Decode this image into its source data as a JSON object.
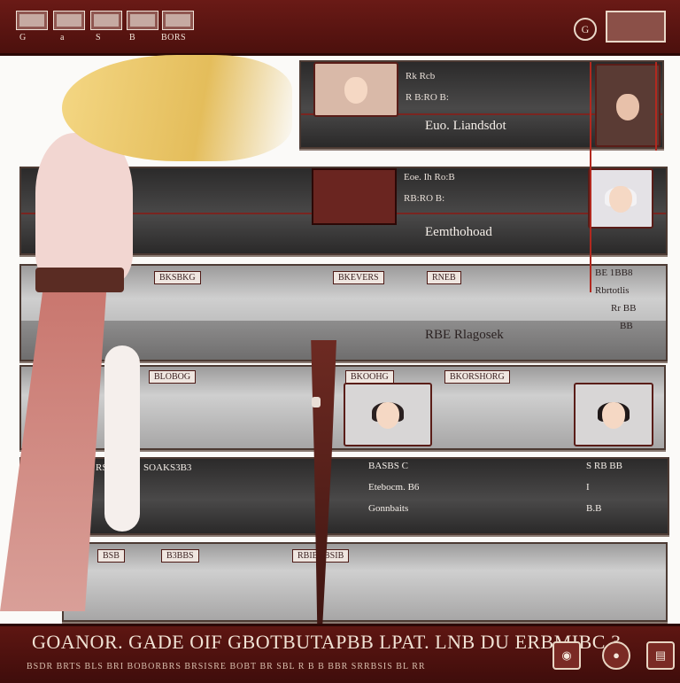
{
  "topbar": {
    "tabs": [
      {
        "label": "G"
      },
      {
        "label": "a"
      },
      {
        "label": "S"
      },
      {
        "label": "B"
      },
      {
        "label": "BORS"
      }
    ],
    "right_icon": "G"
  },
  "panels": [
    {
      "id": "p1",
      "lines": [
        "Rk Rcb",
        "R B:RO B:"
      ],
      "label": "Euo. Liandsdot"
    },
    {
      "id": "p2",
      "lines": [
        "Eoe. Ih Ro:B",
        "RB:RO B:"
      ],
      "label": "Eemthohoad"
    },
    {
      "id": "p3",
      "tags": [
        "BKSBKG",
        "BKEVERS",
        "RNEB"
      ],
      "label": "RBE Rlagosek",
      "side": [
        "BE 1BB8",
        "Rbrtotlis",
        "Rr BB",
        "BB"
      ]
    },
    {
      "id": "p4",
      "tags": [
        "BLOBOG",
        "BKOOHG",
        "BKORSHORG"
      ]
    },
    {
      "id": "p5",
      "left": "RSB",
      "col1": "SOAKS3B3",
      "rows": [
        "BASBS C",
        "Etebocm. B6",
        "Gonnbaits"
      ],
      "right": [
        "S RB BB",
        "I",
        "B.B"
      ]
    },
    {
      "id": "p6",
      "tags": [
        "BSB",
        "B3BBS",
        "RBIBRBSIB"
      ]
    }
  ],
  "bottombar": {
    "title": "GOANOR. GADE OIF GBOTBUTAPBB LPAT. LNB DU ERBMIBC 3",
    "subtitle": "BSDR BRTS BLS BRI BOBORBRS BRSISRE BOBT BR SBL R B B BBR SRRBSIS BL RR"
  },
  "colors": {
    "maroon": "#5e1612",
    "panel_dark": "#3a3939",
    "panel_grey": "#c4c3c3",
    "accent_red": "#b2291f"
  }
}
